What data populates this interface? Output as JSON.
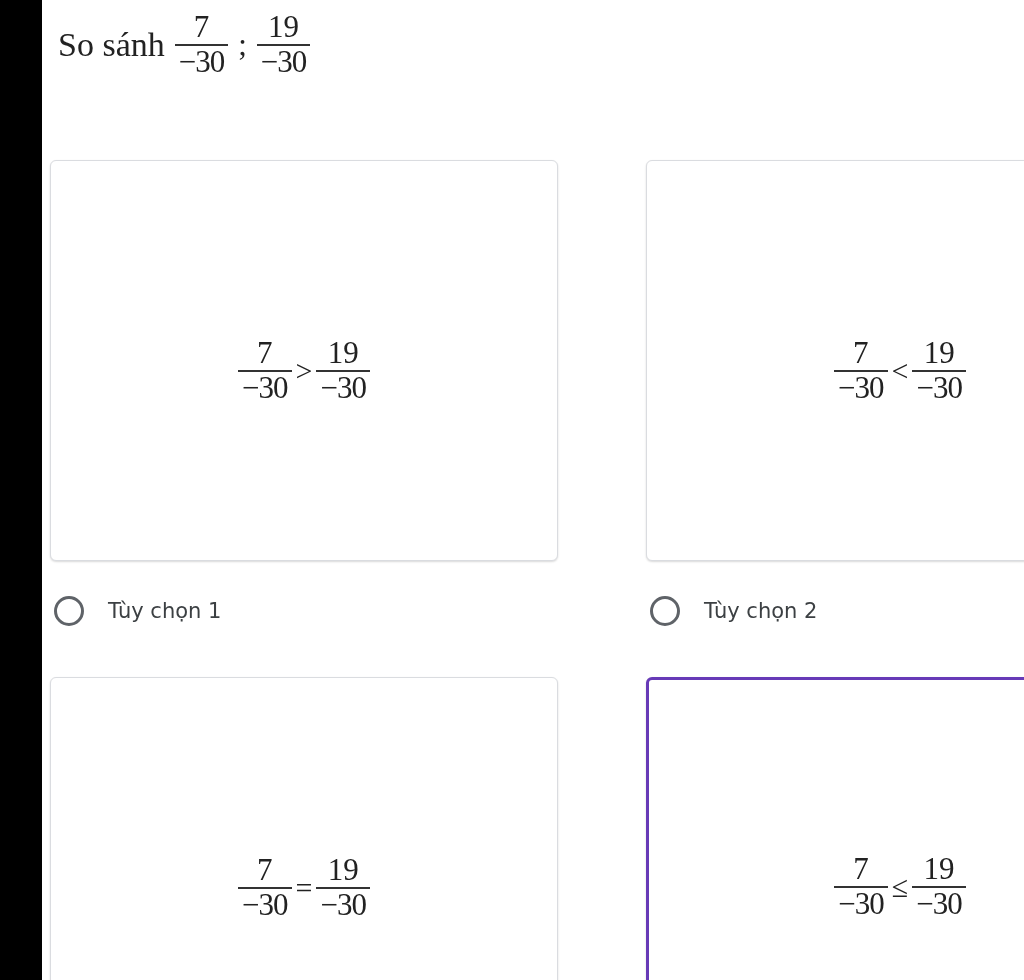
{
  "question": {
    "prefix": "So sánh",
    "fractions": [
      {
        "numerator": "7",
        "denominator": "−30"
      },
      {
        "numerator": "19",
        "denominator": "−30"
      }
    ],
    "separator": ";"
  },
  "options": [
    {
      "left": {
        "numerator": "7",
        "denominator": "−30"
      },
      "sign": ">",
      "right": {
        "numerator": "19",
        "denominator": "−30"
      },
      "label": "Tùy chọn 1",
      "selected": false,
      "highlighted": false
    },
    {
      "left": {
        "numerator": "7",
        "denominator": "−30"
      },
      "sign": "<",
      "right": {
        "numerator": "19",
        "denominator": "−30"
      },
      "label": "Tùy chọn 2",
      "selected": false,
      "highlighted": false
    },
    {
      "left": {
        "numerator": "7",
        "denominator": "−30"
      },
      "sign": "=",
      "right": {
        "numerator": "19",
        "denominator": "−30"
      },
      "highlighted": false
    },
    {
      "left": {
        "numerator": "7",
        "denominator": "−30"
      },
      "sign": "≤",
      "right": {
        "numerator": "19",
        "denominator": "−30"
      },
      "highlighted": true
    }
  ]
}
